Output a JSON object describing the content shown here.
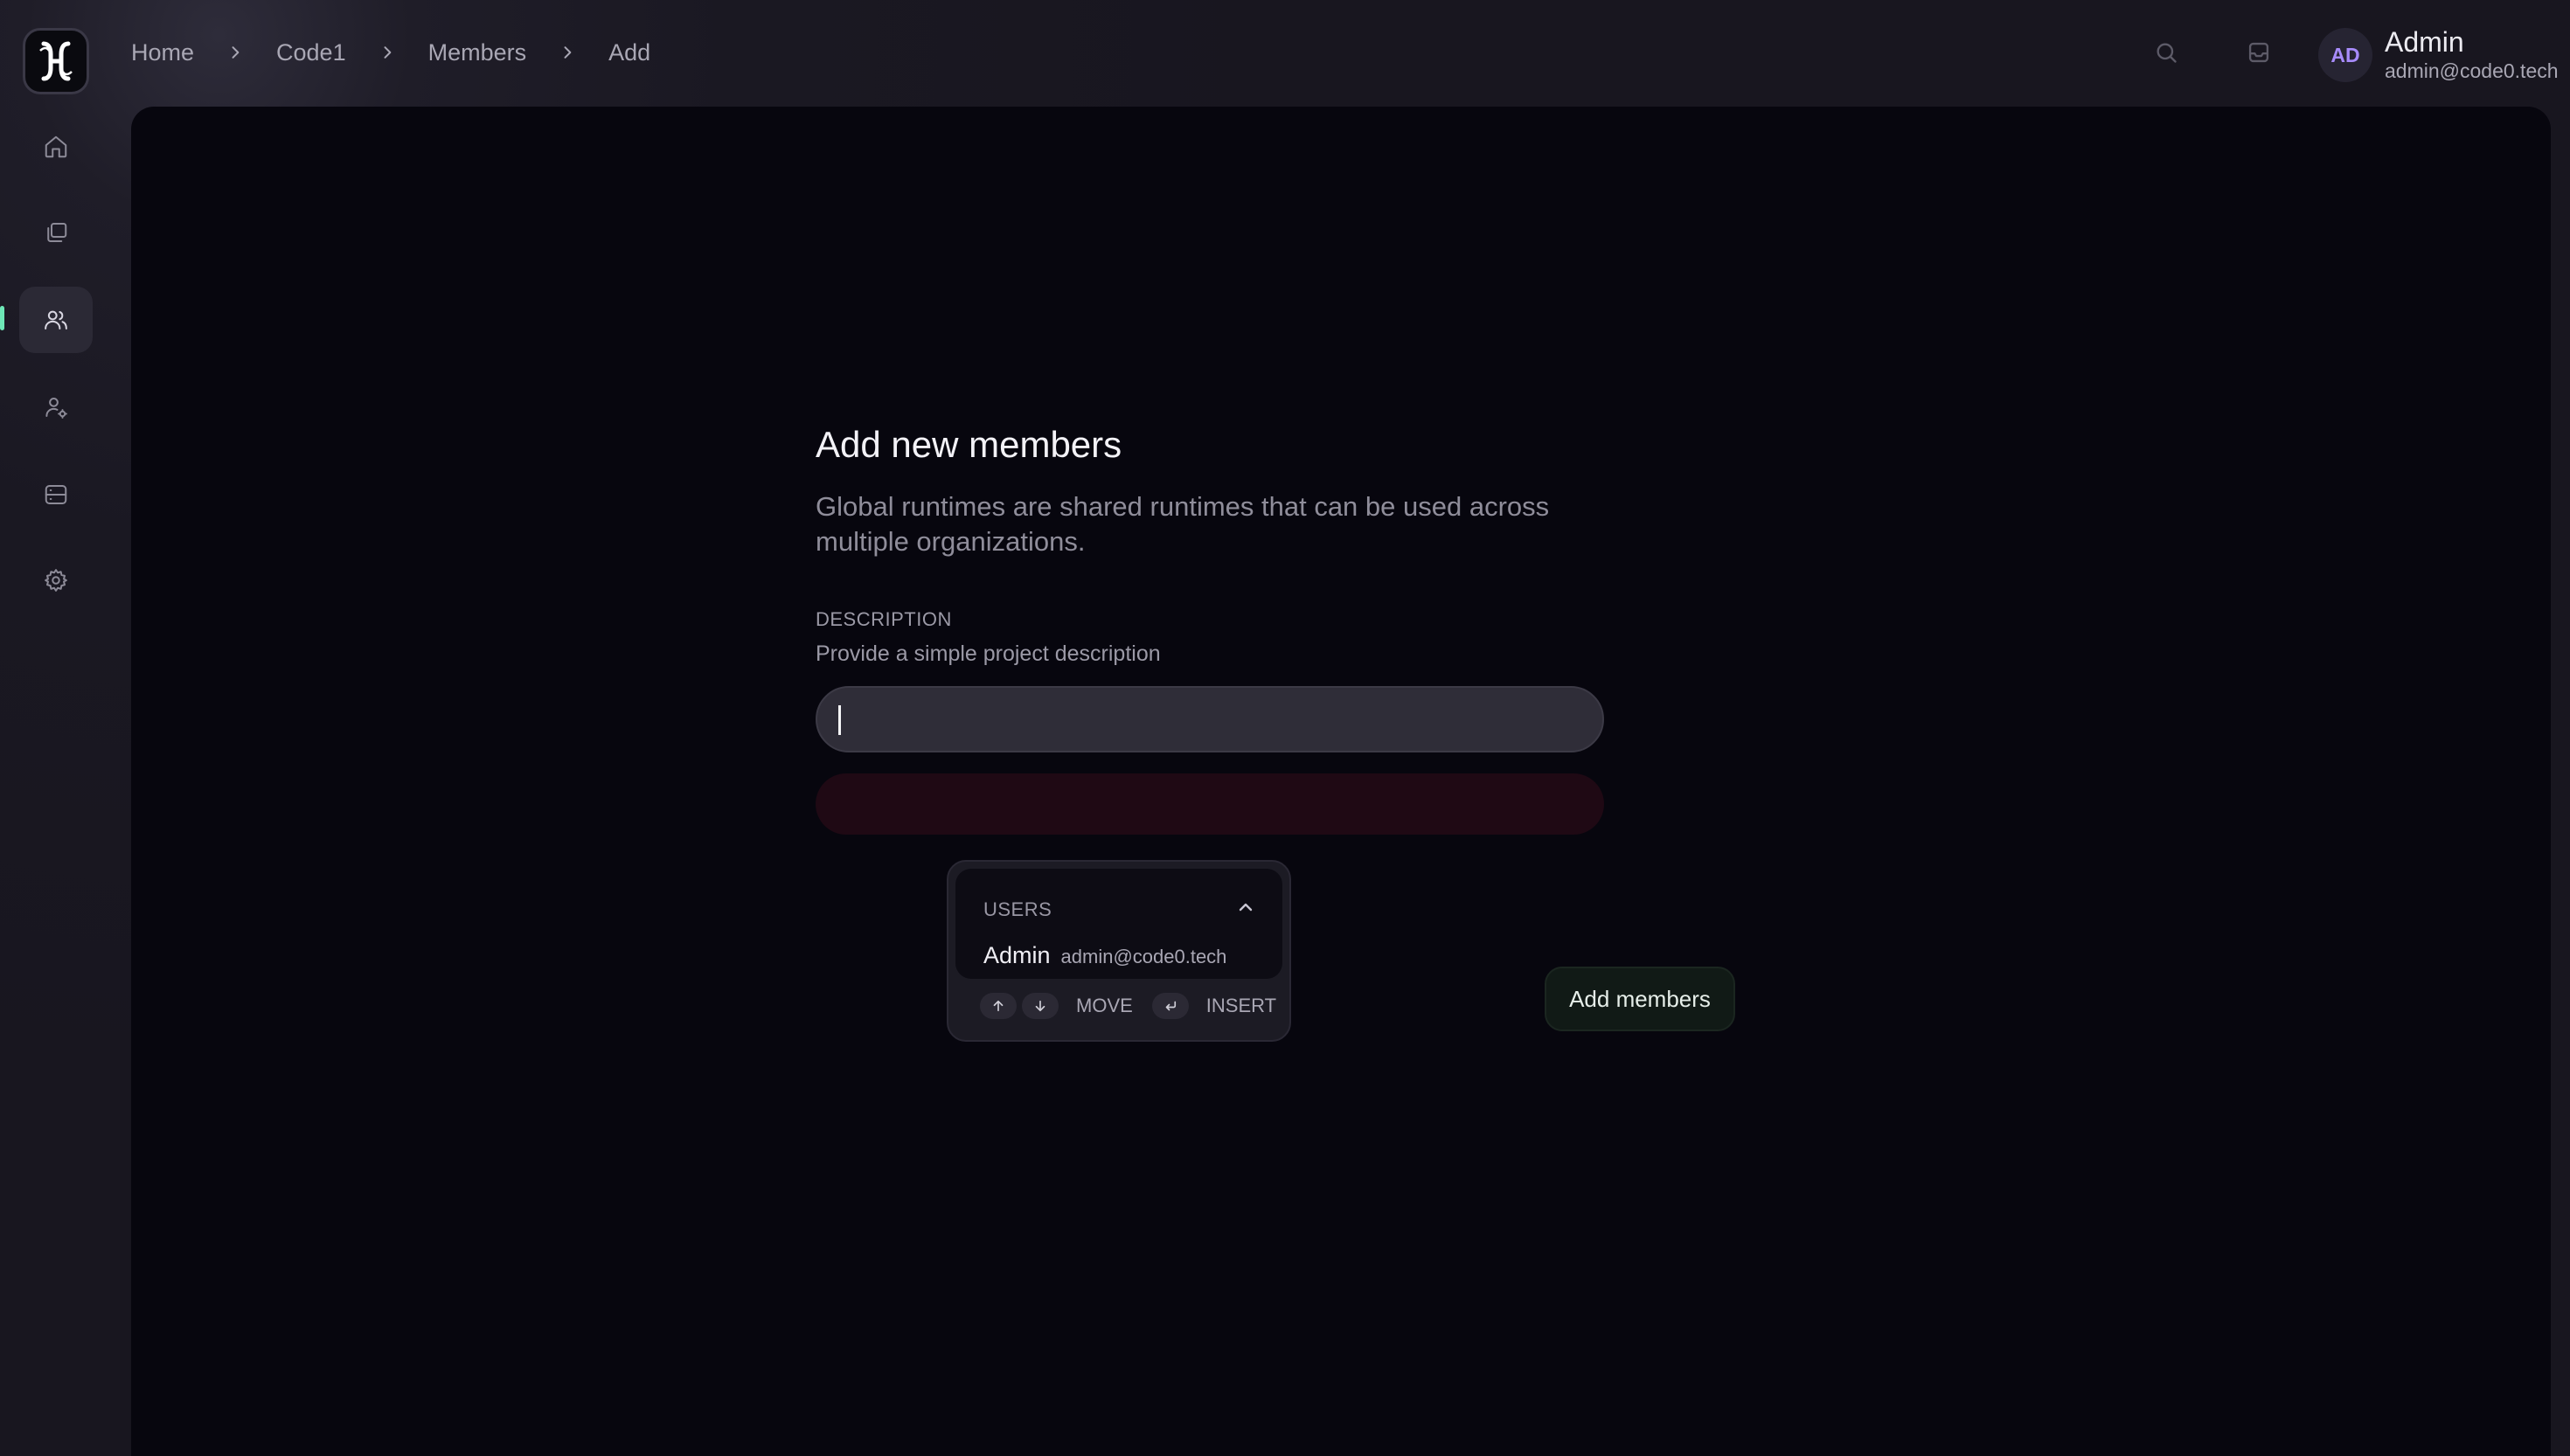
{
  "breadcrumb": {
    "items": [
      "Home",
      "Code1",
      "Members",
      "Add"
    ]
  },
  "sidebar": {
    "items": [
      {
        "name": "home",
        "icon": "home-icon",
        "active": false
      },
      {
        "name": "projects",
        "icon": "folders-icon",
        "active": false
      },
      {
        "name": "members",
        "icon": "users-icon",
        "active": true
      },
      {
        "name": "user-settings",
        "icon": "user-gear-icon",
        "active": false
      },
      {
        "name": "servers",
        "icon": "server-icon",
        "active": false
      },
      {
        "name": "settings",
        "icon": "gear-icon",
        "active": false
      }
    ]
  },
  "header": {
    "avatar_initials": "AD",
    "user_name": "Admin",
    "user_email": "admin@code0.tech"
  },
  "form": {
    "title": "Add new members",
    "subtitle": "Global runtimes are shared runtimes that can be used across multiple organizations.",
    "label": "DESCRIPTION",
    "hint": "Provide a simple project description",
    "input_value": "",
    "submit_label": "Add members"
  },
  "dropdown": {
    "section_label": "USERS",
    "items": [
      {
        "name": "Admin",
        "email": "admin@code0.tech"
      }
    ],
    "footer": {
      "move_label": "MOVE",
      "insert_label": "INSERT"
    }
  },
  "colors": {
    "accent_indicator": "#6ee7b7",
    "avatar_text": "#a78bfa",
    "panel_bg": "#07060e",
    "error_bar": "#1f0914"
  }
}
